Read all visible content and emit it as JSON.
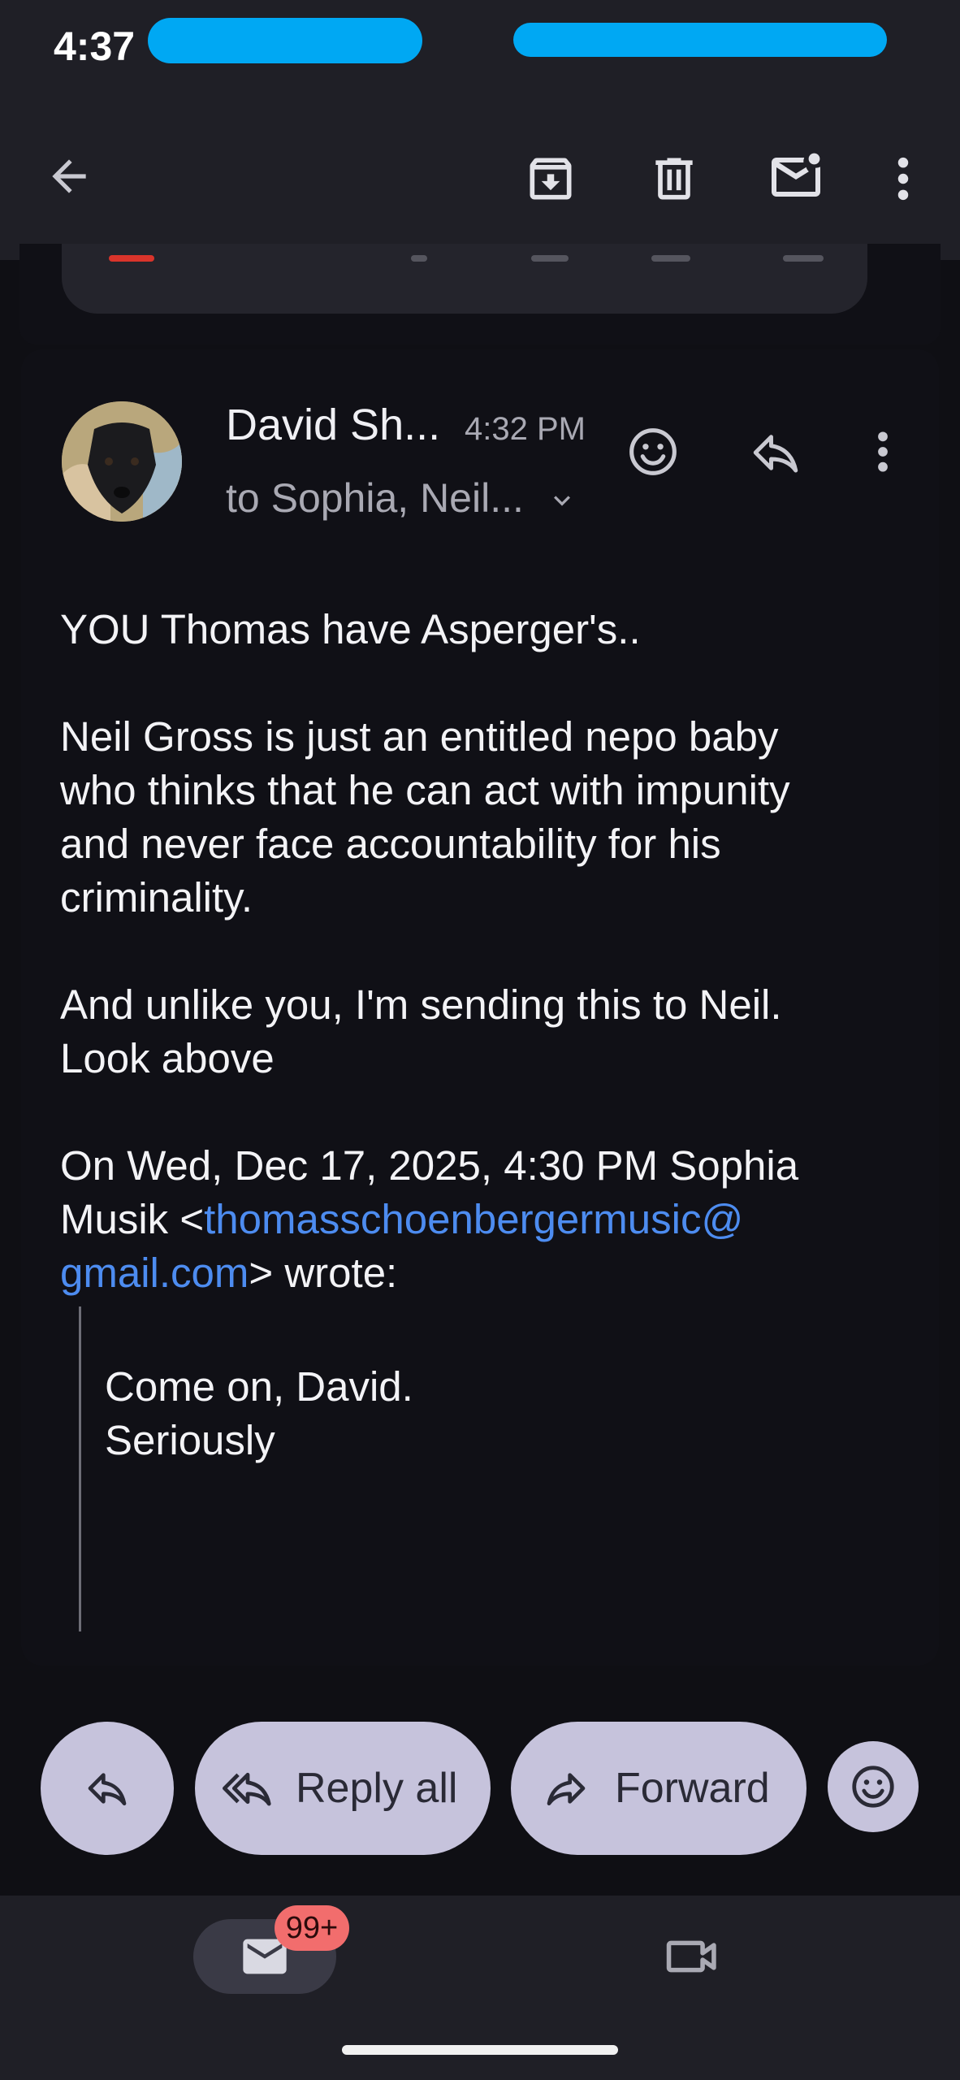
{
  "status_bar": {
    "time": "4:37"
  },
  "message": {
    "sender": "David Sh...",
    "time": "4:32 PM",
    "recipients": "to Sophia, Neil...",
    "body": {
      "p1": "YOU Thomas have Asperger's..",
      "p2_l1": "Neil Gross is just an entitled nepo baby",
      "p2_l2": "who thinks that he can act with impunity",
      "p2_l3": "and never face accountability for his",
      "p2_l4": "criminality.",
      "p3_l1": "And unlike you, I'm sending this to Neil.",
      "p3_l2": "Look above",
      "attr_l1": "On Wed, Dec 17, 2025, 4:30 PM Sophia",
      "attr_l2_prefix": "Musik <",
      "email_l1": "thomasschoenbergermusic@",
      "email_l2": "gmail.com",
      "attr_l3_suffix": "> wrote:"
    },
    "quote": {
      "l1": "Come on, David.",
      "l2": "Seriously"
    }
  },
  "actions": {
    "reply_all": "Reply all",
    "forward": "Forward"
  },
  "bottom_nav": {
    "mail_badge": "99+"
  },
  "colors": {
    "link": "#4d8cf0",
    "action_bg": "#c6c3dc",
    "badge": "#f26d6d",
    "redaction": "#00a8f3"
  }
}
